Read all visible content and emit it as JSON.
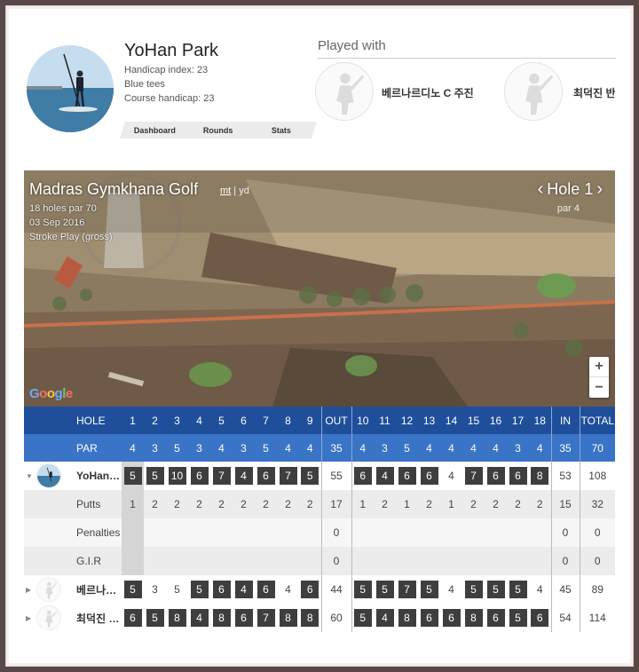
{
  "profile": {
    "name": "YoHan Park",
    "handicap_index": "Handicap index: 23",
    "tees": "Blue tees",
    "course_handicap": "Course handicap: 23",
    "tabs": [
      "Dashboard",
      "Rounds",
      "Stats"
    ]
  },
  "played_with": {
    "title": "Played with",
    "players": [
      "베르나르디노 C 주진",
      "최덕진 반"
    ]
  },
  "map": {
    "course_name": "Madras Gymkhana Golf",
    "unit_mt": "mt",
    "unit_sep": "|",
    "unit_yd": "yd",
    "holes_par": "18 holes par 70",
    "date": "03 Sep 2016",
    "mode": "Stroke Play (gross)",
    "hole_label": "Hole 1",
    "hole_par": "par 4",
    "prev_icon": "chevron-left-icon",
    "next_icon": "chevron-right-icon",
    "zoom_in": "+",
    "zoom_out": "−",
    "google_logo": "Google"
  },
  "scorecard": {
    "hole_label": "HOLE",
    "par_label": "PAR",
    "holes": [
      "1",
      "2",
      "3",
      "4",
      "5",
      "6",
      "7",
      "8",
      "9",
      "OUT",
      "10",
      "11",
      "12",
      "13",
      "14",
      "15",
      "16",
      "17",
      "18",
      "IN",
      "TOTAL"
    ],
    "par": [
      "4",
      "3",
      "5",
      "3",
      "4",
      "3",
      "5",
      "4",
      "4",
      "35",
      "4",
      "3",
      "5",
      "4",
      "4",
      "4",
      "4",
      "3",
      "4",
      "35",
      "70"
    ],
    "players": [
      {
        "name": "YoHan Park",
        "display": "YoHan…",
        "scores": [
          "5",
          "5",
          "10",
          "6",
          "7",
          "4",
          "6",
          "7",
          "5",
          "55",
          "6",
          "4",
          "6",
          "6",
          "4",
          "7",
          "6",
          "6",
          "8",
          "53",
          "108"
        ],
        "expanded": true
      },
      {
        "name": "베르나르디노 C 주진",
        "display": "베르나…",
        "scores": [
          "5",
          "3",
          "5",
          "5",
          "6",
          "4",
          "6",
          "4",
          "6",
          "44",
          "5",
          "5",
          "7",
          "5",
          "4",
          "5",
          "5",
          "5",
          "4",
          "45",
          "89"
        ],
        "expanded": false
      },
      {
        "name": "최덕진 반",
        "display": "최덕진 …",
        "scores": [
          "6",
          "5",
          "8",
          "4",
          "8",
          "6",
          "7",
          "8",
          "8",
          "60",
          "5",
          "4",
          "8",
          "6",
          "6",
          "8",
          "6",
          "5",
          "6",
          "54",
          "114"
        ],
        "expanded": false
      }
    ],
    "stats": [
      {
        "label": "Putts",
        "values": [
          "1",
          "2",
          "2",
          "2",
          "2",
          "2",
          "2",
          "2",
          "2",
          "17",
          "1",
          "2",
          "1",
          "2",
          "1",
          "2",
          "2",
          "2",
          "2",
          "15",
          "32"
        ]
      },
      {
        "label": "Penalties",
        "values": [
          "",
          "",
          "",
          "",
          "",
          "",
          "",
          "",
          "",
          "0",
          "",
          "",
          "",
          "",
          "",
          "",
          "",
          "",
          "",
          "0",
          "0"
        ]
      },
      {
        "label": "G.I.R",
        "values": [
          "",
          "",
          "",
          "",
          "",
          "",
          "",
          "",
          "",
          "0",
          "",
          "",
          "",
          "",
          "",
          "",
          "",
          "",
          "",
          "0",
          "0"
        ]
      }
    ]
  },
  "colors": {
    "hole_row": "#1f4f9a",
    "par_row": "#3a74c6",
    "over_par_box": "#3e3e3e"
  }
}
